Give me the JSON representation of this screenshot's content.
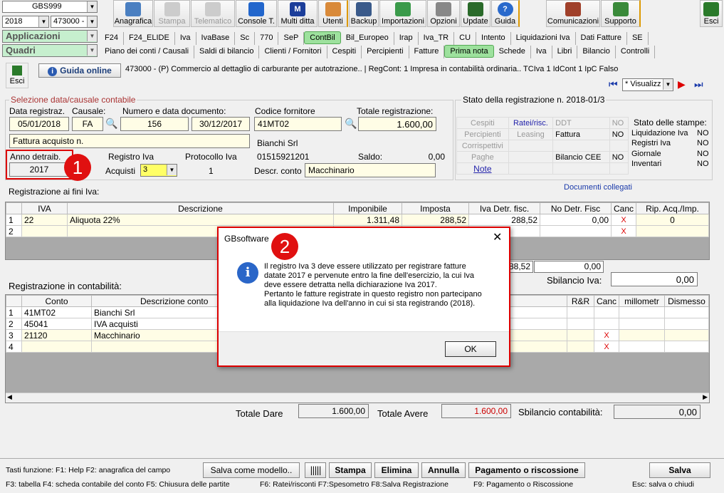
{
  "toolbar": {
    "company": "GBS999",
    "year": "2018",
    "code": "473000 -",
    "applicazioni": "Applicazioni",
    "quadri": "Quadri",
    "buttons": [
      "Anagrafica",
      "Stampa",
      "Telematico",
      "Console T.",
      "Multi ditta",
      "Utenti",
      "Backup",
      "Importazioni",
      "Opzioni",
      "Update",
      "Guida",
      "Comunicazioni",
      "Supporto",
      "Esci"
    ]
  },
  "tabs_row1": [
    "F24",
    "F24_ELIDE",
    "Iva",
    "IvaBase",
    "Sc",
    "770",
    "SeP",
    "ContBil",
    "Bil_Europeo",
    "Irap",
    "Iva_TR",
    "CU",
    "Intento",
    "Liquidazioni Iva",
    "Dati Fatture",
    "SE"
  ],
  "tabs_row2": [
    "Piano dei conti / Causali",
    "Saldi di bilancio",
    "Clienti / Fornitori",
    "Cespiti",
    "Percipienti",
    "Fatture",
    "Prima nota",
    "Schede",
    "Iva",
    "Libri",
    "Bilancio",
    "Controlli"
  ],
  "infobar": {
    "exit": "Esci",
    "guide": "Guida online",
    "info": "473000 - (P) Commercio al dettaglio di carburante per autotrazione.. | RegCont: 1 Impresa  in contabilità ordinaria..  TCIva 1 IdCont 1 IpC Falso",
    "view": "* Visualizz"
  },
  "selection": {
    "title": "Selezione data/causale contabile",
    "date_label": "Data registraz.",
    "date": "05/01/2018",
    "causale_label": "Causale:",
    "causale": "FA",
    "num_label": "Numero e data documento:",
    "num": "156",
    "doc_date": "30/12/2017",
    "description": "Fattura acquisto n.",
    "anno_label": "Anno detraib.",
    "anno": "2017",
    "registro_label": "Registro Iva",
    "acquisti_label": "Acquisti",
    "registro": "3",
    "protocollo_label": "Protocollo Iva",
    "protocollo": "1",
    "fornitore_label": "Codice fornitore",
    "fornitore": "41MT02",
    "totale_label": "Totale registrazione:",
    "totale": "1.600,00",
    "fornitore_name": "Bianchi Srl",
    "phone": "01515921201",
    "saldo_label": "Saldo:",
    "saldo": "0,00",
    "descr_conto_label": "Descr. conto",
    "descr_conto": "Macchinario"
  },
  "stato": {
    "title": "Stato della registrazione n. 2018-01/3",
    "rows": [
      [
        "Cespiti",
        "Ratei/risc.",
        "DDT",
        "NO"
      ],
      [
        "Percipienti",
        "Leasing",
        "Fattura",
        "NO"
      ],
      [
        "Corrispettivi",
        "",
        "",
        ""
      ],
      [
        "Paghe",
        "",
        "Bilancio CEE",
        "NO"
      ],
      [
        "Note",
        "",
        "",
        ""
      ]
    ],
    "stampe_title": "Stato delle stampe:",
    "stampe": [
      [
        "Liquidazione Iva",
        "NO"
      ],
      [
        "Registri Iva",
        "NO"
      ],
      [
        "Giornale",
        "NO"
      ],
      [
        "Inventari",
        "NO"
      ]
    ]
  },
  "iva": {
    "title": "Registrazione ai fini Iva:",
    "docs_link": "Documenti collegati",
    "headers": [
      "",
      "IVA",
      "Descrizione",
      "Imponibile",
      "Imposta",
      "Iva Detr. fisc.",
      "No Detr. Fisc",
      "Canc",
      "Rip. Acq./Imp."
    ],
    "rows": [
      [
        "1",
        "22",
        "Aliquota 22%",
        "1.311,48",
        "288,52",
        "288,52",
        "0,00",
        "X",
        "0"
      ],
      [
        "2",
        "",
        "",
        "",
        "",
        "",
        "",
        "X",
        ""
      ]
    ],
    "tot_detr": "288,52",
    "tot_nodetr": "0,00",
    "sbilancio_label": "Sbilancio Iva:",
    "sbilancio": "0,00"
  },
  "cont": {
    "title": "Registrazione in contabilità:",
    "headers": [
      "",
      "Conto",
      "Descrizione conto",
      "R&R",
      "Canc",
      "millometr",
      "Dismesso"
    ],
    "rows": [
      [
        "1",
        "41MT02",
        "Bianchi Srl",
        "",
        "",
        ""
      ],
      [
        "2",
        "45041",
        "IVA acquisti",
        "",
        "",
        ""
      ],
      [
        "3",
        "21120",
        "Macchinario",
        "",
        "X",
        ""
      ],
      [
        "4",
        "",
        "",
        "",
        "X",
        ""
      ]
    ],
    "dare_label": "Totale Dare",
    "dare": "1.600,00",
    "avere_label": "Totale Avere",
    "avere": "1.600,00",
    "sbil_label": "Sbilancio contabilità:",
    "sbil": "0,00"
  },
  "footer": {
    "keys1": "Tasti funzione:  F1: Help  F2: anagrafica del campo",
    "keys2": "F3: tabella   F4: scheda contabile del conto   F5: Chiusura delle partite",
    "keys3": "F6: Ratei/risconti   F7:Spesometro   F8:Salva Registrazione",
    "keys4": "F9: Pagamento o Riscossione",
    "keys5": "Esc: salva o chiudi",
    "salva_modello": "Salva come modello..",
    "stampa": "Stampa",
    "elimina": "Elimina",
    "annulla": "Annulla",
    "pagamento": "Pagamento o riscossione",
    "salva": "Salva"
  },
  "dialog": {
    "title": "GBsoftware",
    "message": "Il registro Iva 3 deve essere utilizzato per registrare fatture datate 2017 e pervenute entro la fine dell'esercizio, la cui Iva deve essere detratta nella dichiarazione Iva 2017.\nPertanto le fatture registrate in questo registro non partecipano alla liquidazione Iva dell'anno in cui si sta registrando (2018).",
    "ok": "OK"
  },
  "markers": [
    "1",
    "2"
  ]
}
